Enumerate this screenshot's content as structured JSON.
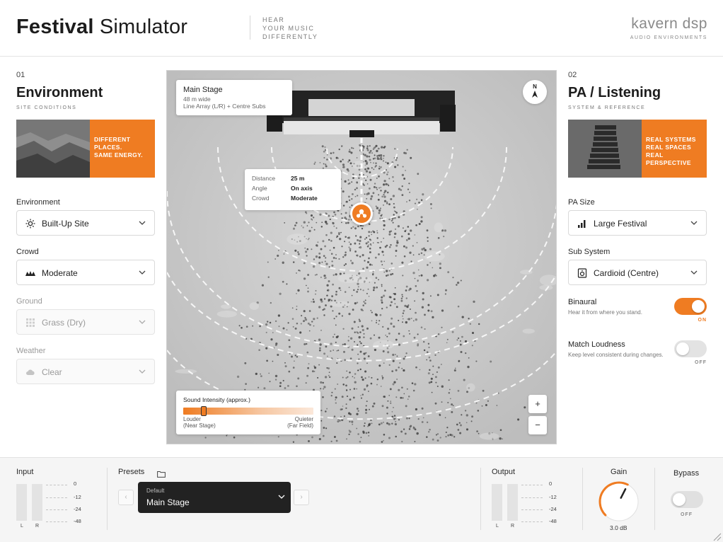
{
  "header": {
    "title_bold": "Festival",
    "title_light": "Simulator",
    "tagline": [
      "HEAR",
      "YOUR MUSIC",
      "DIFFERENTLY"
    ],
    "brand_name": "kavern dsp",
    "brand_sub": "AUDIO ENVIRONMENTS"
  },
  "environment": {
    "number": "01",
    "title": "Environment",
    "subtitle": "SITE CONDITIONS",
    "promo": [
      "DIFFERENT",
      "PLACES.",
      "SAME ENERGY."
    ],
    "fields": [
      {
        "label": "Environment",
        "value": "Built-Up Site",
        "icon": "sun-icon",
        "disabled": false
      },
      {
        "label": "Crowd",
        "value": "Moderate",
        "icon": "crowd-icon",
        "disabled": false
      },
      {
        "label": "Ground",
        "value": "Grass (Dry)",
        "icon": "grid-icon",
        "disabled": true
      },
      {
        "label": "Weather",
        "value": "Clear",
        "icon": "cloud-icon",
        "disabled": true
      }
    ]
  },
  "pa": {
    "number": "02",
    "title": "PA / Listening",
    "subtitle": "SYSTEM & REFERENCE",
    "promo": [
      "REAL SYSTEMS",
      "REAL SPACES",
      "REAL PERSPECTIVE"
    ],
    "fields": [
      {
        "label": "PA Size",
        "value": "Large Festival",
        "icon": "bars-icon"
      },
      {
        "label": "Sub System",
        "value": "Cardioid (Centre)",
        "icon": "speaker-icon"
      }
    ],
    "binaural": {
      "title": "Binaural",
      "desc": "Hear it from where you stand.",
      "state": "ON"
    },
    "match_loudness": {
      "title": "Match Loudness",
      "desc": "Keep level consistent during changes.",
      "state": "OFF"
    }
  },
  "map": {
    "stage_card": {
      "title": "Main Stage",
      "line1": "48 m wide",
      "line2": "Line Array (L/R) + Centre Subs"
    },
    "info": [
      {
        "key": "Distance",
        "value": "25 m"
      },
      {
        "key": "Angle",
        "value": "On axis"
      },
      {
        "key": "Crowd",
        "value": "Moderate"
      }
    ],
    "compass": "N",
    "zoom_in": "+",
    "zoom_out": "−",
    "intensity": {
      "title": "Sound Intensity (approx.)",
      "position": 0.16,
      "left_label": "Louder",
      "left_sub": "(Near Stage)",
      "right_label": "Quieter",
      "right_sub": "(Far Field)"
    }
  },
  "footer": {
    "input_label": "Input",
    "output_label": "Output",
    "meter_left": "L",
    "meter_right": "R",
    "scale": [
      "0",
      "-12",
      "-24",
      "-48"
    ],
    "presets_label": "Presets",
    "preset_caption": "Default",
    "preset_value": "Main Stage",
    "prev": "‹",
    "next": "›",
    "gain_label": "Gain",
    "gain_value": "3.0 dB",
    "gain_fraction": 0.6,
    "bypass_label": "Bypass",
    "bypass_state": "OFF"
  },
  "colors": {
    "accent": "#ef7c22",
    "dark": "#222222"
  }
}
